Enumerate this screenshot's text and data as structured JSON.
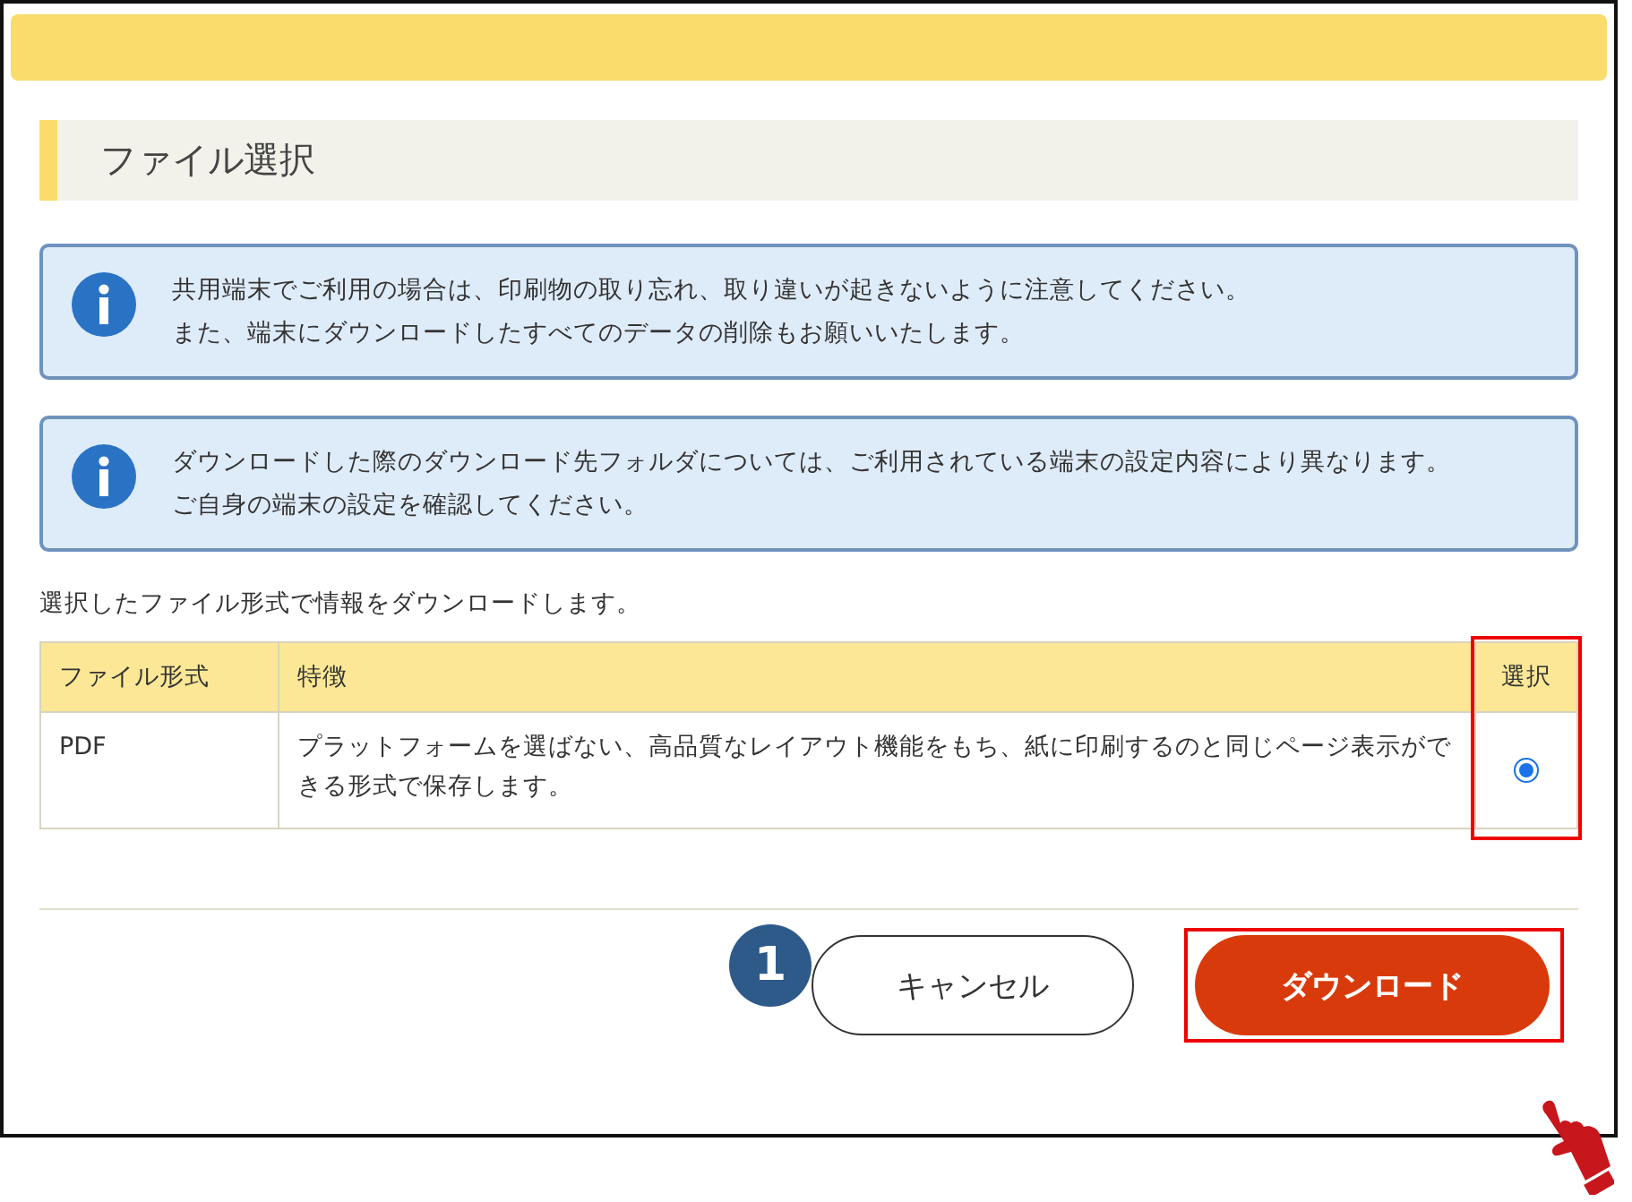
{
  "heading": "ファイル選択",
  "notices": [
    {
      "lines": [
        "共用端末でご利用の場合は、印刷物の取り忘れ、取り違いが起きないように注意してください。",
        "また、端末にダウンロードしたすべてのデータの削除もお願いいたします。"
      ]
    },
    {
      "lines": [
        "ダウンロードした際のダウンロード先フォルダについては、ご利用されている端末の設定内容により異なります。",
        "ご自身の端末の設定を確認してください。"
      ]
    }
  ],
  "intro": "選択したファイル形式で情報をダウンロードします。",
  "table": {
    "columns": [
      "ファイル形式",
      "特徴",
      "選択"
    ],
    "rows": [
      {
        "format": "PDF",
        "description": "プラットフォームを選ばない、高品質なレイアウト機能をもち、紙に印刷するのと同じページ表示ができる形式で保存します。",
        "selected": true
      }
    ]
  },
  "step_badge": "1",
  "buttons": [
    {
      "label": "キャンセル",
      "kind": "secondary"
    },
    {
      "label": "ダウンロード",
      "kind": "primary"
    }
  ]
}
